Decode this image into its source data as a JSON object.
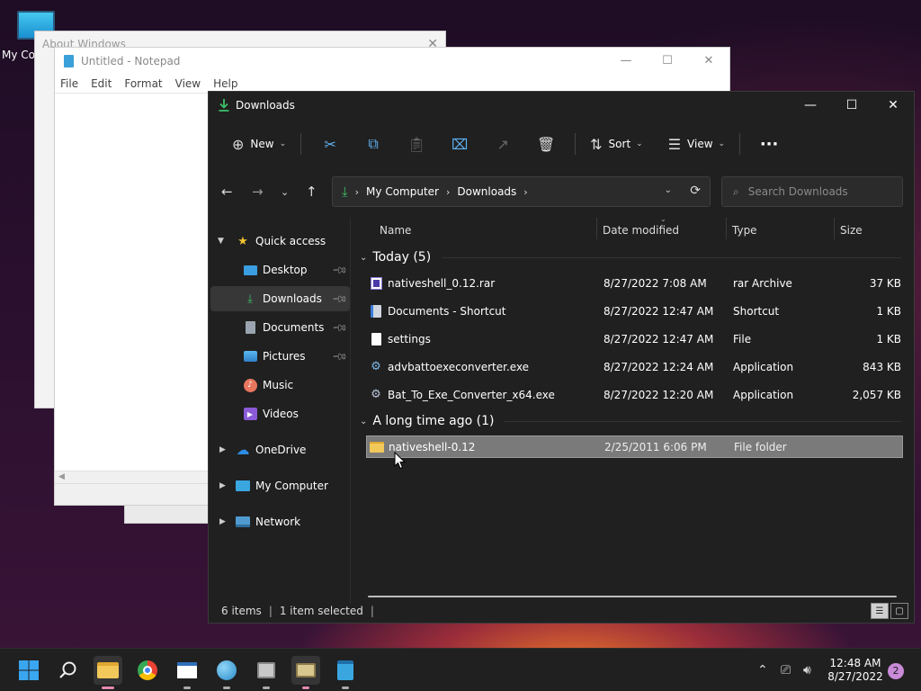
{
  "desktop": {
    "icon_label": "My Co"
  },
  "about": {
    "title": "About Windows",
    "close": "✕"
  },
  "notepad": {
    "title": "Untitled - Notepad",
    "menu": [
      "File",
      "Edit",
      "Format",
      "View",
      "Help"
    ]
  },
  "explorer": {
    "title": "Downloads",
    "toolbar": {
      "new_label": "New",
      "sort_label": "Sort",
      "view_label": "View",
      "more": "···"
    },
    "address": {
      "crumb1": "My Computer",
      "crumb2": "Downloads"
    },
    "search": {
      "placeholder": "Search Downloads"
    },
    "sidebar": {
      "quick_access": "Quick access",
      "items": [
        "Desktop",
        "Downloads",
        "Documents",
        "Pictures",
        "Music",
        "Videos"
      ],
      "onedrive": "OneDrive",
      "my_computer": "My Computer",
      "network": "Network"
    },
    "columns": {
      "name": "Name",
      "date": "Date modified",
      "type": "Type",
      "size": "Size"
    },
    "groups": {
      "today": "Today (5)",
      "long_ago": "A long time ago (1)"
    },
    "files": [
      {
        "name": "nativeshell_0.12.rar",
        "date": "8/27/2022 7:08 AM",
        "type": "rar Archive",
        "size": "37 KB"
      },
      {
        "name": "Documents - Shortcut",
        "date": "8/27/2022 12:47 AM",
        "type": "Shortcut",
        "size": "1 KB"
      },
      {
        "name": "settings",
        "date": "8/27/2022 12:47 AM",
        "type": "File",
        "size": "1 KB"
      },
      {
        "name": "advbattoexeconverter.exe",
        "date": "8/27/2022 12:24 AM",
        "type": "Application",
        "size": "843 KB"
      },
      {
        "name": "Bat_To_Exe_Converter_x64.exe",
        "date": "8/27/2022 12:20 AM",
        "type": "Application",
        "size": "2,057 KB"
      }
    ],
    "old_files": [
      {
        "name": "nativeshell-0.12",
        "date": "2/25/2011 6:06 PM",
        "type": "File folder",
        "size": ""
      }
    ],
    "status": {
      "count": "6 items",
      "selected": "1 item selected"
    }
  },
  "taskbar": {
    "time": "12:48 AM",
    "date": "8/27/2022",
    "notifications": "2"
  },
  "colors": {
    "accent_green": "#3fbf6a",
    "selection": "#7a7a7a",
    "explorer_bg": "#202020"
  }
}
